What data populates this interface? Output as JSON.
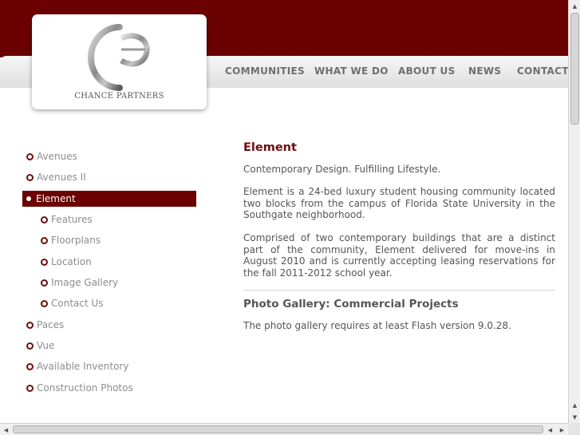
{
  "brand": {
    "name": "CHANCE PARTNERS"
  },
  "nav": [
    {
      "label": "COMMUNITIES"
    },
    {
      "label": "WHAT WE DO"
    },
    {
      "label": "ABOUT US"
    },
    {
      "label": "NEWS"
    },
    {
      "label": "CONTACT U"
    }
  ],
  "sidebar": {
    "items": [
      {
        "label": "Avenues"
      },
      {
        "label": "Avenues II"
      },
      {
        "label": "Element",
        "active": true
      },
      {
        "label": "Features"
      },
      {
        "label": "Floorplans"
      },
      {
        "label": "Location"
      },
      {
        "label": "Image Gallery"
      },
      {
        "label": "Contact Us"
      },
      {
        "label": "Paces"
      },
      {
        "label": "Vue"
      },
      {
        "label": "Available Inventory"
      },
      {
        "label": "Construction Photos"
      }
    ]
  },
  "main": {
    "title": "Element",
    "tagline": "Contemporary Design. Fulfilling Lifestyle.",
    "paragraph1": "Element is a 24-bed luxury student housing community located two blocks from the campus of Florida State University in the Southgate neighborhood.",
    "paragraph2": "Comprised of two contemporary buildings that are a distinct part of the community, Element delivered for move-ins in August 2010 and is currently accepting leasing reservations for the fall 2011-2012 school year.",
    "gallery_title": "Photo Gallery: Commercial Projects",
    "flash_notice": "The photo gallery requires at least Flash version 9.0.28."
  },
  "colors": {
    "brand_maroon": "#6b0000",
    "accent": "#7a0a0a",
    "text": "#555555",
    "nav_text": "#6f6f6f"
  }
}
